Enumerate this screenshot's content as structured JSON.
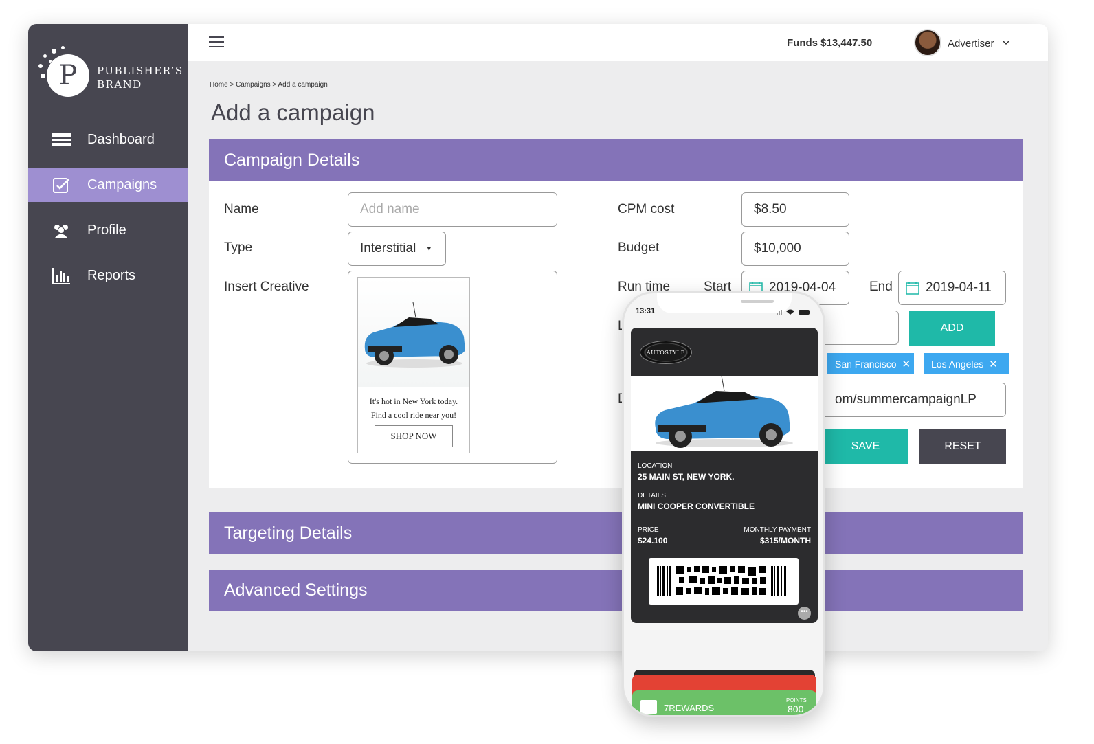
{
  "brand": {
    "line1": "PUBLISHER’S",
    "line2": "BRAND",
    "logo_letter": "P"
  },
  "sidebar": {
    "items": [
      {
        "label": "Dashboard",
        "icon": "dashboard-icon"
      },
      {
        "label": "Campaigns",
        "icon": "campaign-check-icon",
        "active": true
      },
      {
        "label": "Profile",
        "icon": "profile-users-icon"
      },
      {
        "label": "Reports",
        "icon": "bar-chart-icon"
      }
    ]
  },
  "header": {
    "funds": "Funds $13,447.50",
    "user": "Advertiser"
  },
  "breadcrumb": "Home > Campaigns > Add a campaign",
  "page_title": "Add a campaign",
  "campaign_details": {
    "title": "Campaign Details",
    "name_label": "Name",
    "name_placeholder": "Add name",
    "type_label": "Type",
    "type_value": "Interstitial",
    "creative_label": "Insert Creative",
    "creative": {
      "text_line1": "It's hot in New York today.",
      "text_line2": "Find a cool ride near you!",
      "button": "SHOP NOW"
    },
    "cpm_label": "CPM cost",
    "cpm_value": "$8.50",
    "budget_label": "Budget",
    "budget_value": "$10,000",
    "runtime_label": "Run time",
    "start_label": "Start",
    "start_value": "2019-04-04",
    "end_label": "End",
    "end_value": "2019-04-11",
    "location_label_partial": "L",
    "add_button": "ADD",
    "tags": [
      "San Francisco",
      "Los Angeles"
    ],
    "destination_label_partial": "D",
    "url_partial": "om/summercampaignLP",
    "save_button": "SAVE",
    "reset_button": "RESET"
  },
  "targeting_title": "Targeting Details",
  "advanced_title": "Advanced Settings",
  "phone": {
    "time": "13:31",
    "pass_brand": "AUTOSTYLE",
    "location_label": "LOCATION",
    "location_value": "25 MAIN ST, NEW YORK.",
    "details_label": "DETAILS",
    "details_value": "MINI COOPER CONVERTIBLE",
    "price_label": "PRICE",
    "price_value": "$24.100",
    "monthly_label": "MONTHLY PAYMENT",
    "monthly_value": "$315/MONTH",
    "more": "•••",
    "rewards_label": "7REWARDS",
    "points_label": "POINTS",
    "points_value": "800"
  },
  "colors": {
    "sidebar": "#474650",
    "active": "#9e8fd1",
    "panel": "#8473b8",
    "teal": "#1fb9a8",
    "tag": "#3da8f0"
  }
}
